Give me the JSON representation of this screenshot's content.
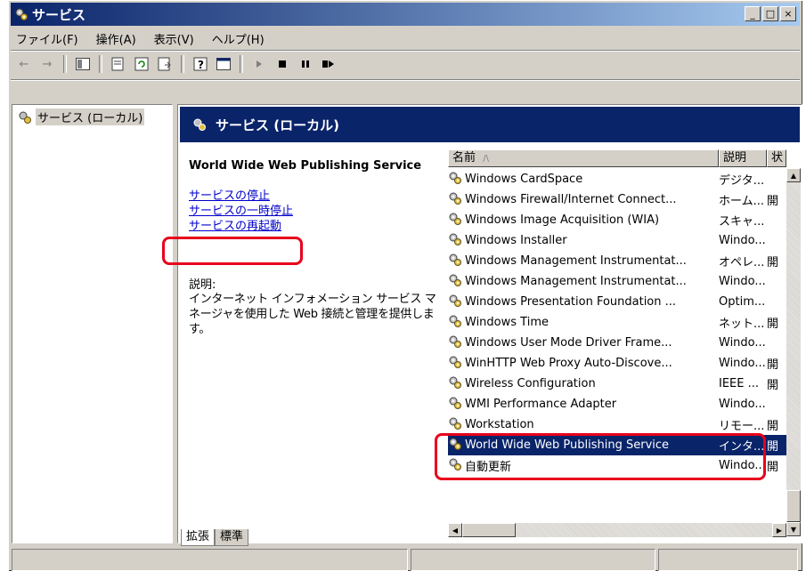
{
  "window": {
    "title": "サービス",
    "buttons": {
      "minimize": "_",
      "maximize": "□",
      "close": "×"
    }
  },
  "menu": [
    "ファイル(F)",
    "操作(A)",
    "表示(V)",
    "ヘルプ(H)"
  ],
  "toolbar_icons": [
    "back-arrow-icon",
    "forward-arrow-icon",
    "show-hide-tree-icon",
    "properties-icon",
    "refresh-icon",
    "export-list-icon",
    "help-icon",
    "console-icon",
    "start-service-icon",
    "stop-service-icon",
    "pause-service-icon",
    "restart-service-icon"
  ],
  "tree": {
    "root_label": "サービス (ローカル)"
  },
  "panel": {
    "header_title": "サービス (ローカル)",
    "service_title": "World Wide Web Publishing Service",
    "links": [
      "サービスの停止",
      "サービスの一時停止",
      "サービスの再起動"
    ],
    "description_label": "説明:",
    "description_text": "インターネット インフォメーション サービス マネージャを使用した Web 接続と管理を提供します。"
  },
  "list": {
    "columns": [
      "名前",
      "説明",
      "状"
    ],
    "sort_indicator": "/\\",
    "rows": [
      {
        "name": "Windows CardSpace",
        "desc": "デジタ...",
        "status": ""
      },
      {
        "name": "Windows Firewall/Internet Connect...",
        "desc": "ホーム...",
        "status": "開"
      },
      {
        "name": "Windows Image Acquisition (WIA)",
        "desc": "スキャ...",
        "status": ""
      },
      {
        "name": "Windows Installer",
        "desc": "Windo...",
        "status": ""
      },
      {
        "name": "Windows Management Instrumentat...",
        "desc": "オペレ...",
        "status": "開"
      },
      {
        "name": "Windows Management Instrumentat...",
        "desc": "Windo...",
        "status": ""
      },
      {
        "name": "Windows Presentation Foundation ...",
        "desc": "Optim...",
        "status": ""
      },
      {
        "name": "Windows Time",
        "desc": "ネット...",
        "status": "開"
      },
      {
        "name": "Windows User Mode Driver Frame...",
        "desc": "Windo...",
        "status": ""
      },
      {
        "name": "WinHTTP Web Proxy Auto-Discove...",
        "desc": "Windo...",
        "status": "開"
      },
      {
        "name": "Wireless Configuration",
        "desc": "IEEE ...",
        "status": "開"
      },
      {
        "name": "WMI Performance Adapter",
        "desc": "Windo...",
        "status": ""
      },
      {
        "name": "Workstation",
        "desc": "リモー...",
        "status": "開"
      },
      {
        "name": "World Wide Web Publishing Service",
        "desc": "インタ...",
        "status": "開"
      },
      {
        "name": "自動更新",
        "desc": "Windo...",
        "status": "開"
      }
    ],
    "selected_index": 13
  },
  "tabs": [
    "拡張",
    "標準"
  ],
  "colors": {
    "highlight": "#e8001c",
    "selection": "#0a246a",
    "link": "#0000cc"
  }
}
